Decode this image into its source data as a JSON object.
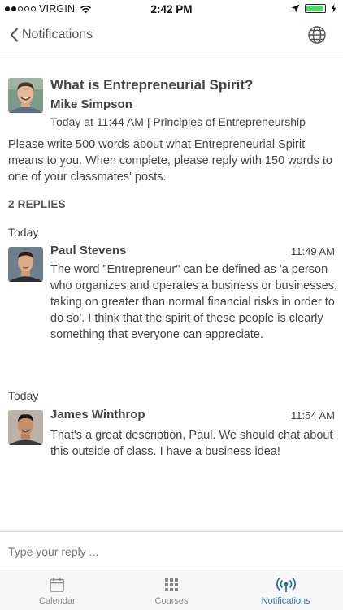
{
  "status_bar": {
    "carrier": "VIRGIN",
    "time": "2:42 PM",
    "battery_level": 0.95
  },
  "nav": {
    "back_label": "Notifications",
    "globe_icon": "globe-icon"
  },
  "post": {
    "title": "What is Entrepreneurial Spirit?",
    "author": "Mike Simpson",
    "meta": "Today at 11:44 AM | Principles of Entrepreneurship",
    "body": "Please write 500 words about what Entrepreneurial Spirit means to you. When complete, please reply with 150 words to one of your classmates' posts."
  },
  "replies_count": "2 REPLIES",
  "replies": [
    {
      "day": "Today",
      "name": "Paul Stevens",
      "time": "11:49 AM",
      "text": "The word \"Entrepreneur\" can be defined as 'a person who organizes and operates a business or businesses, taking on greater than normal financial risks in order to do so'. I think that the spirit of these people is clearly something that everyone can appreciate."
    },
    {
      "day": "Today",
      "name": "James Winthrop",
      "time": "11:54 AM",
      "text": "That's a great description, Paul. We should chat about this outside of class. I have a business idea!"
    }
  ],
  "composer": {
    "placeholder": "Type your reply ..."
  },
  "tabs": [
    {
      "label": "Calendar",
      "icon": "calendar-icon"
    },
    {
      "label": "Courses",
      "icon": "grid-icon"
    },
    {
      "label": "Notifications",
      "icon": "broadcast-icon",
      "active": true
    }
  ],
  "colors": {
    "accent": "#2a6fb8",
    "battery": "#4cd964",
    "inactive_tab": "#888888"
  }
}
